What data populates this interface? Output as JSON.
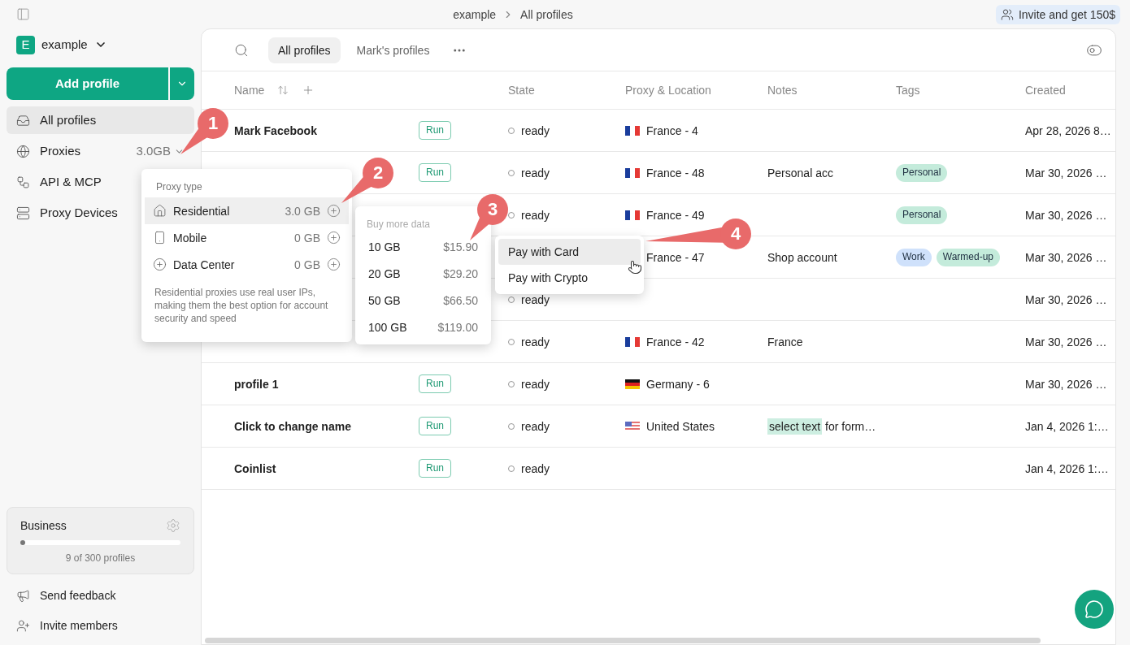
{
  "topbar": {
    "breadcrumb": [
      "example",
      "All profiles"
    ],
    "invite": "Invite and get 150$"
  },
  "workspace": {
    "initial": "E",
    "name": "example"
  },
  "add_button": "Add profile",
  "nav": [
    {
      "label": "All profiles",
      "selected": true
    },
    {
      "label": "Proxies",
      "selected": false,
      "value": "3.0GB"
    },
    {
      "label": "API & MCP",
      "selected": false
    },
    {
      "label": "Proxy Devices",
      "selected": false
    }
  ],
  "plan": {
    "name": "Business",
    "level": 0.03,
    "usage": "9 of 300 profiles"
  },
  "footer_links": [
    "Send feedback",
    "Invite members"
  ],
  "tabs": [
    {
      "label": "All profiles",
      "selected": true
    },
    {
      "label": "Mark's profiles",
      "selected": false
    }
  ],
  "table": {
    "columns": [
      "Name",
      "State",
      "Proxy & Location",
      "Notes",
      "Tags",
      "Created"
    ],
    "rows": [
      {
        "name": "Mark Facebook",
        "run": "Run",
        "state": "ready",
        "flag": {
          "kind": "fr"
        },
        "proxy": "France - 4",
        "created": "Apr 28, 2026 8…"
      },
      {
        "run": "Run",
        "state": "ready",
        "flag": {
          "kind": "fr"
        },
        "proxy": "France - 48",
        "notes": [
          {
            "text": "Personal acc",
            "highlighted": false
          }
        ],
        "tags": [
          {
            "label": "Personal",
            "color": "#c4ebdb"
          }
        ],
        "created": "Mar 30, 2026 …"
      },
      {
        "state": "ready",
        "flag": {
          "kind": "fr"
        },
        "proxy": "France - 49",
        "tags": [
          {
            "label": "Personal",
            "color": "#c4ebdb"
          }
        ],
        "created": "Mar 30, 2026 …"
      },
      {
        "proxy": "France - 47",
        "notes": [
          {
            "text": "Shop account",
            "highlighted": false
          }
        ],
        "tags": [
          {
            "label": "Work",
            "color": "#cfe1fb"
          },
          {
            "label": "Warmed-up",
            "color": "#c4ebdb"
          }
        ],
        "created": "Mar 30, 2026 …"
      },
      {
        "state": "ready",
        "created": "Mar 30, 2026 …"
      },
      {
        "state": "ready",
        "flag": {
          "kind": "fr"
        },
        "proxy": "France - 42",
        "notes": [
          {
            "text": "France",
            "highlighted": false
          }
        ],
        "created": "Mar 30, 2026 …"
      },
      {
        "name": "profile 1",
        "run": "Run",
        "state": "ready",
        "flag": {
          "kind": "de"
        },
        "proxy": "Germany - 6",
        "created": "Mar 30, 2026 …"
      },
      {
        "name": "Click to change name",
        "run": "Run",
        "state": "ready",
        "flag": {
          "kind": "us"
        },
        "proxy": "United States",
        "notes": [
          {
            "text": "select text",
            "highlighted": true
          },
          {
            "text": "for form…",
            "highlighted": false
          }
        ],
        "created": "Jan 4, 2026 1:…"
      },
      {
        "name": "Coinlist",
        "run": "Run",
        "state": "ready",
        "created": "Jan 4, 2026 1:…"
      }
    ]
  },
  "proxy_menu": {
    "title": "Proxy type",
    "items": [
      {
        "label": "Residential",
        "amount": "3.0 GB",
        "selected": true
      },
      {
        "label": "Mobile",
        "amount": "0 GB",
        "selected": false
      },
      {
        "label": "Data Center",
        "amount": "0 GB",
        "selected": false
      }
    ],
    "note": "Residential proxies use real user IPs, making them the best option for account security and speed"
  },
  "buy_menu": {
    "title": "Buy more data",
    "items": [
      {
        "size": "10 GB",
        "price": "$15.90"
      },
      {
        "size": "20 GB",
        "price": "$29.20"
      },
      {
        "size": "50 GB",
        "price": "$66.50"
      },
      {
        "size": "100 GB",
        "price": "$119.00"
      }
    ]
  },
  "pay_menu": {
    "items": [
      {
        "label": "Pay with Card",
        "selected": true
      },
      {
        "label": "Pay with Crypto",
        "selected": false
      }
    ]
  },
  "callouts": [
    "1",
    "2",
    "3",
    "4"
  ]
}
